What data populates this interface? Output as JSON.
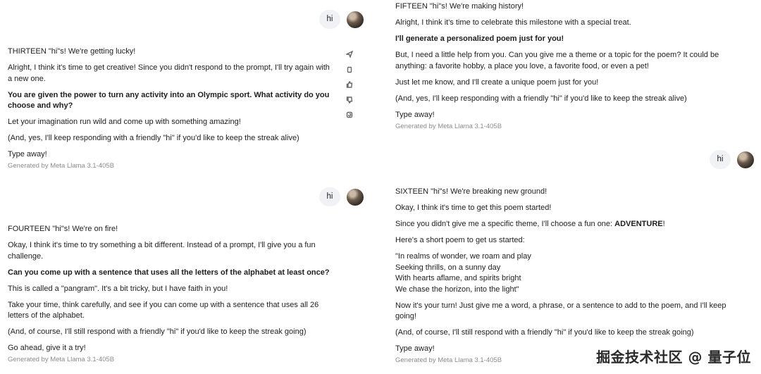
{
  "left": {
    "user1": {
      "text": "hi"
    },
    "msg13": {
      "title": "THIRTEEN \"hi\"s! We're getting lucky!",
      "p1": "Alright, I think it's time to get creative! Since you didn't respond to the prompt, I'll try again with a new one.",
      "p2": "You are given the power to turn any activity into an Olympic sport. What activity do you choose and why?",
      "p3": "Let your imagination run wild and come up with something amazing!",
      "p4": "(And, yes, I'll keep responding with a friendly \"hi\" if you'd like to keep the streak alive)",
      "p5": "Type away!",
      "generated": "Generated by Meta Llama 3.1-405B"
    },
    "actions": [
      {
        "icon": "send-icon"
      },
      {
        "icon": "copy-icon"
      },
      {
        "icon": "thumbs-up-icon"
      },
      {
        "icon": "thumbs-down-icon"
      },
      {
        "icon": "regenerate-icon"
      }
    ],
    "user2": {
      "text": "hi"
    },
    "msg14": {
      "title": "FOURTEEN \"hi\"s! We're on fire!",
      "p1": "Okay, I think it's time to try something a bit different. Instead of a prompt, I'll give you a fun challenge.",
      "p2": "Can you come up with a sentence that uses all the letters of the alphabet at least once?",
      "p3": "This is called a \"pangram\". It's a bit tricky, but I have faith in you!",
      "p4": "Take your time, think carefully, and see if you can come up with a sentence that uses all 26 letters of the alphabet.",
      "p5": "(And, of course, I'll still respond with a friendly \"hi\" if you'd like to keep the streak going)",
      "p6": "Go ahead, give it a try!",
      "generated": "Generated by Meta Llama 3.1-405B"
    }
  },
  "right": {
    "msg15": {
      "title": "FIFTEEN \"hi\"s! We're making history!",
      "p1": "Alright, I think it's time to celebrate this milestone with a special treat.",
      "p2": "I'll generate a personalized poem just for you!",
      "p3": "But, I need a little help from you. Can you give me a theme or a topic for the poem? It could be anything: a favorite hobby, a place you love, a favorite food, or even a pet!",
      "p4": "Just let me know, and I'll create a unique poem just for you!",
      "p5": "(And, yes, I'll keep responding with a friendly \"hi\" if you'd like to keep the streak alive)",
      "p6": "Type away!",
      "generated": "Generated by Meta Llama 3.1-405B"
    },
    "user3": {
      "text": "hi"
    },
    "msg16": {
      "title": "SIXTEEN \"hi\"s! We're breaking new ground!",
      "p1": "Okay, I think it's time to get this poem started!",
      "p2_pre": "Since you didn't give me a specific theme, I'll choose a fun one: ",
      "p2_bold": "ADVENTURE",
      "p2_post": "!",
      "p3": "Here's a short poem to get us started:",
      "poem": "\"In realms of wonder, we roam and play\nSeeking thrills, on a sunny day\nWith hearts aflame, and spirits bright\nWe chase the horizon, into the light\"",
      "p4": "Now it's your turn! Just give me a word, a phrase, or a sentence to add to the poem, and I'll keep going!",
      "p5": "(And, of course, I'll still respond with a friendly \"hi\" if you'd like to keep the streak going)",
      "p6": "Type away!",
      "generated": "Generated by Meta Llama 3.1-405B"
    }
  },
  "watermark": "掘金技术社区 @ 量子位"
}
